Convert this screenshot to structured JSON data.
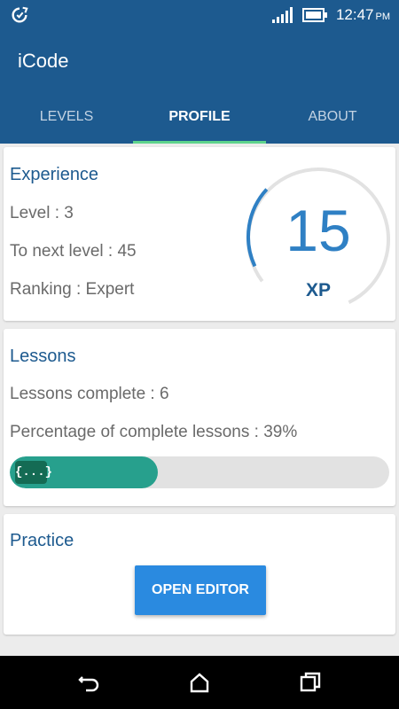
{
  "status_bar": {
    "time": "12:47",
    "ampm": "PM",
    "icons": [
      "sync-icon",
      "signal-icon",
      "battery-icon"
    ]
  },
  "app": {
    "title": "iCode"
  },
  "tabs": [
    {
      "label": "LEVELS",
      "active": false
    },
    {
      "label": "PROFILE",
      "active": true
    },
    {
      "label": "ABOUT",
      "active": false
    }
  ],
  "experience": {
    "title": "Experience",
    "level": "Level : 3",
    "to_next": "To next level : 45",
    "ranking": "Ranking : Expert",
    "xp_value": "15",
    "xp_label": "XP",
    "xp_progress": 0.25
  },
  "lessons": {
    "title": "Lessons",
    "complete": "Lessons complete : 6",
    "percentage": "Percentage of complete lessons : 39%",
    "progress": 0.39,
    "badge": "{...}"
  },
  "practice": {
    "title": "Practice",
    "button": "OPEN EDITOR"
  },
  "colors": {
    "primary": "#1d5a8f",
    "tab_indicator": "#5ed38c",
    "xp_arc": "#2f80c4",
    "progress_fill": "#27a08d",
    "button": "#2a8ae0"
  },
  "nav_icons": [
    "back-icon",
    "home-icon",
    "recent-apps-icon"
  ]
}
